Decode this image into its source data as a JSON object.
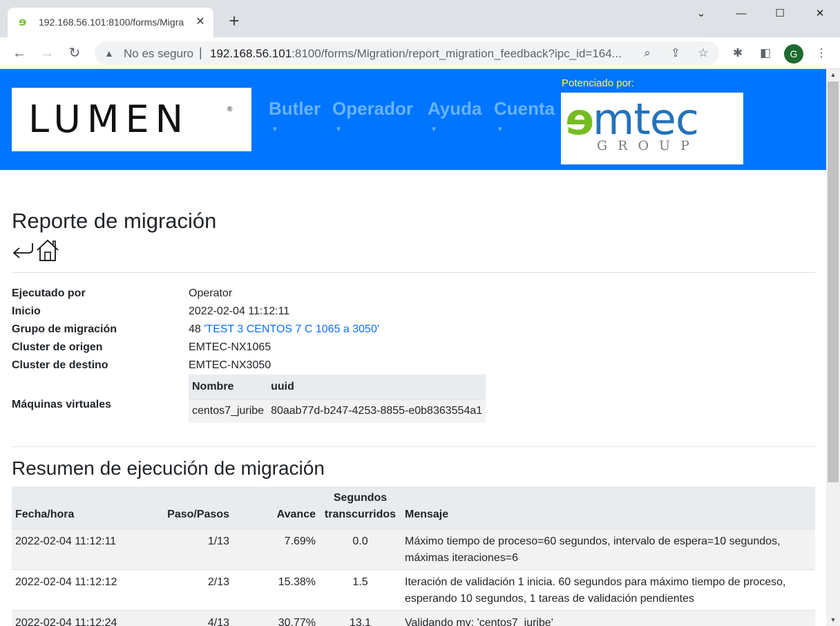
{
  "browser": {
    "tab_title": "192.168.56.101:8100/forms/Migra",
    "favicon": "emtec-favicon",
    "security_text": "No es seguro",
    "url_host": "192.168.56.101",
    "url_rest": ":8100/forms/Migration/report_migration_feedback?ipc_id=164...",
    "profile_initial": "G"
  },
  "header": {
    "logo_text": "LUMEN",
    "menu": [
      {
        "label": "Butler"
      },
      {
        "label": "Operador"
      },
      {
        "label": "Ayuda"
      },
      {
        "label": "Cuenta"
      }
    ],
    "powered_by": "Potenciado por:",
    "partner_logo_e": "e",
    "partner_logo_rest": "mtec",
    "partner_logo_sub": "GROUP"
  },
  "page": {
    "title": "Reporte de migración"
  },
  "details": {
    "executed_by": {
      "label": "Ejecutado por",
      "value": "Operator"
    },
    "start": {
      "label": "Inicio",
      "value": "2022-02-04 11:12:11"
    },
    "group": {
      "label": "Grupo de migración",
      "id": "48",
      "name": "'TEST 3 CENTOS 7 C 1065 a 3050'"
    },
    "source": {
      "label": "Cluster de origen",
      "value": "EMTEC-NX1065"
    },
    "target": {
      "label": "Cluster de destino",
      "value": "EMTEC-NX3050"
    },
    "vms": {
      "label": "Máquinas virtuales",
      "headers": {
        "name": "Nombre",
        "uuid": "uuid"
      },
      "rows": [
        {
          "name": "centos7_juribe",
          "uuid": "80aab77d-b247-4253-8855-e0b8363554a1"
        }
      ]
    }
  },
  "summary": {
    "title": "Resumen de ejecución de migración",
    "headers": {
      "date": "Fecha/hora",
      "step": "Paso/Pasos",
      "progress": "Avance",
      "seconds_line1": "Segundos",
      "seconds_line2": "transcurridos",
      "message": "Mensaje"
    },
    "rows": [
      {
        "date": "2022-02-04 11:12:11",
        "step": "1/13",
        "progress": "7.69%",
        "seconds": "0.0",
        "message": "Máximo tiempo de proceso=60 segundos, intervalo de espera=10 segundos, máximas iteraciones=6"
      },
      {
        "date": "2022-02-04 11:12:12",
        "step": "2/13",
        "progress": "15.38%",
        "seconds": "1.5",
        "message": "Iteración de validación 1 inicia. 60 segundos para máximo tiempo de proceso, esperando 10 segundos, 1 tareas de validación pendientes"
      },
      {
        "date": "2022-02-04 11:12:24",
        "step": "4/13",
        "progress": "30.77%",
        "seconds": "13.1",
        "message": "Validando mv: 'centos7_juribe'"
      }
    ]
  }
}
